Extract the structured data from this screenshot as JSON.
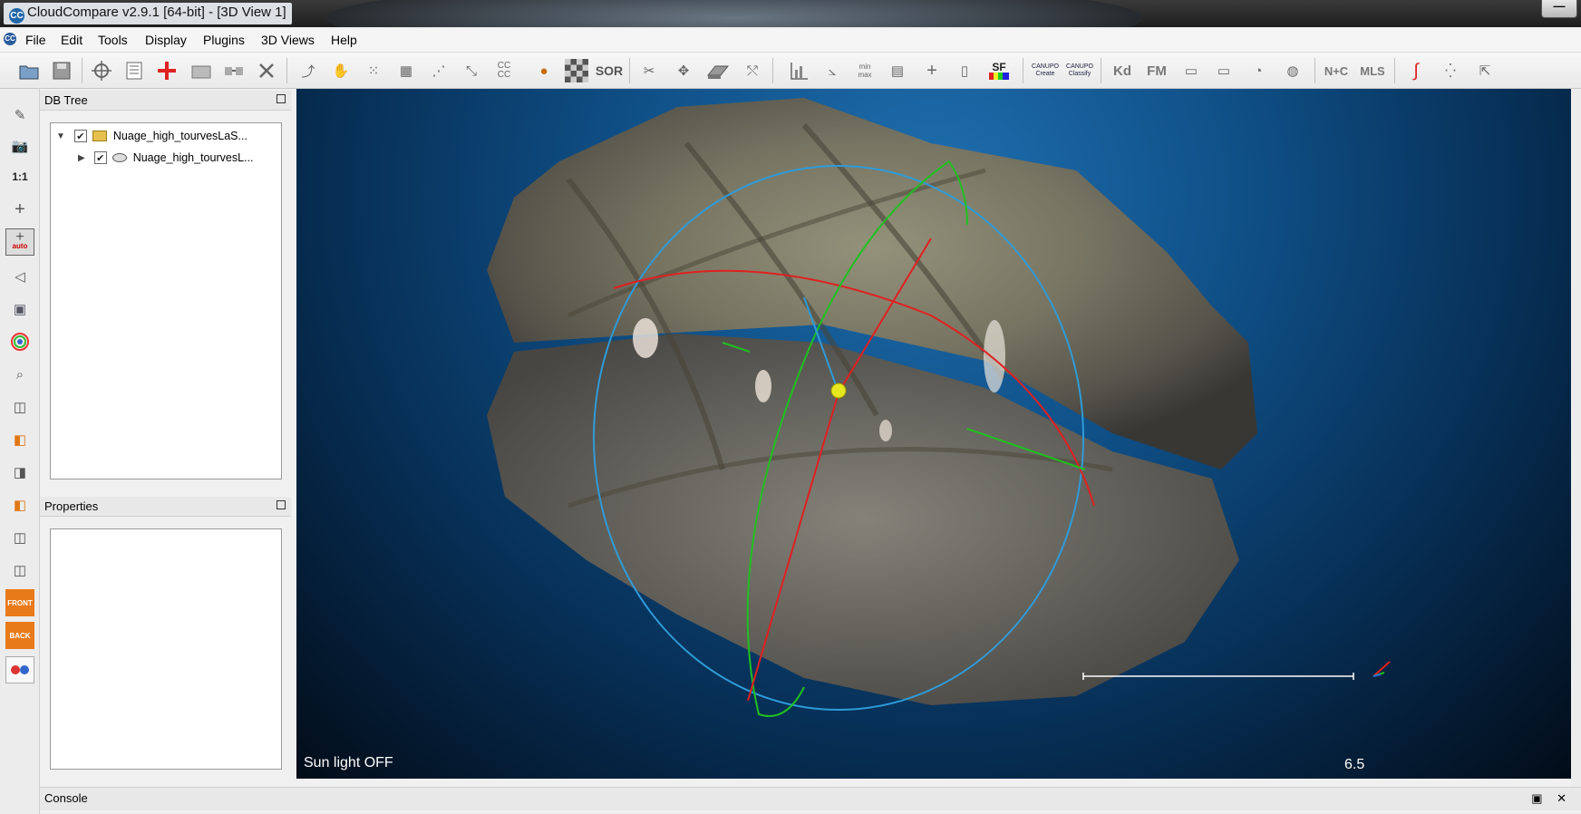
{
  "window": {
    "title": "CloudCompare v2.9.1 [64-bit] - [3D View 1]",
    "logo": "CC",
    "minimize": "—"
  },
  "menu": {
    "items": [
      "File",
      "Edit",
      "Tools",
      "Display",
      "Plugins",
      "3D Views",
      "Help"
    ]
  },
  "toolbar": {
    "labels": {
      "sf": "SF",
      "sor": "SOR",
      "cc": "CC CC",
      "minmax": "min max",
      "canupo_create": "CANUPO Create",
      "canupo_classify": "CANUPO Classify",
      "kd": "Kd",
      "fm": "FM",
      "nc": "N+C",
      "mls": "MLS"
    }
  },
  "left_toolbar": {
    "one_to_one": "1:1",
    "auto": "auto",
    "front": "FRONT",
    "back": "BACK"
  },
  "db_tree": {
    "title": "DB Tree",
    "items": [
      {
        "label": "Nuage_high_tourvesLaS...",
        "checked": true,
        "expanded": true
      },
      {
        "label": "Nuage_high_tourvesL...",
        "checked": true,
        "expanded": false
      }
    ]
  },
  "properties": {
    "title": "Properties"
  },
  "view3d": {
    "sun_light": "Sun light OFF",
    "scale_value": "6.5"
  },
  "console": {
    "title": "Console",
    "buttons": "▣ ✕"
  }
}
